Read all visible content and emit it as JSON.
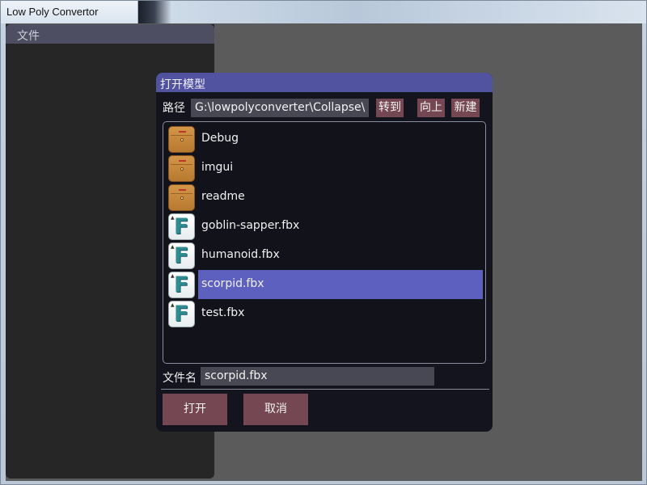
{
  "window": {
    "title": "Low Poly Convertor"
  },
  "menubar": {
    "file_label": "文件"
  },
  "dialog": {
    "title": "打开模型",
    "path_label": "路径",
    "path_value": "G:\\lowpolyconverter\\Collapse\\",
    "goto_label": "转到",
    "up_label": "向上",
    "new_label": "新建",
    "files": [
      {
        "name": "Debug",
        "icon": "folder-icon",
        "selected": false
      },
      {
        "name": "imgui",
        "icon": "folder-icon",
        "selected": false
      },
      {
        "name": "readme",
        "icon": "folder-icon",
        "selected": false
      },
      {
        "name": "goblin-sapper.fbx",
        "icon": "fbx-file-icon",
        "selected": false
      },
      {
        "name": "humanoid.fbx",
        "icon": "fbx-file-icon",
        "selected": false
      },
      {
        "name": "scorpid.fbx",
        "icon": "fbx-file-icon",
        "selected": true
      },
      {
        "name": "test.fbx",
        "icon": "fbx-file-icon",
        "selected": false
      }
    ],
    "filename_label": "文件名",
    "filename_value": "scorpid.fbx",
    "open_label": "打开",
    "cancel_label": "取消"
  },
  "colors": {
    "dialog_header": "#5152a0",
    "button": "#744752",
    "selection": "#5e60c0",
    "client_bg": "#5b5b5b",
    "panel_bg": "#262626"
  }
}
